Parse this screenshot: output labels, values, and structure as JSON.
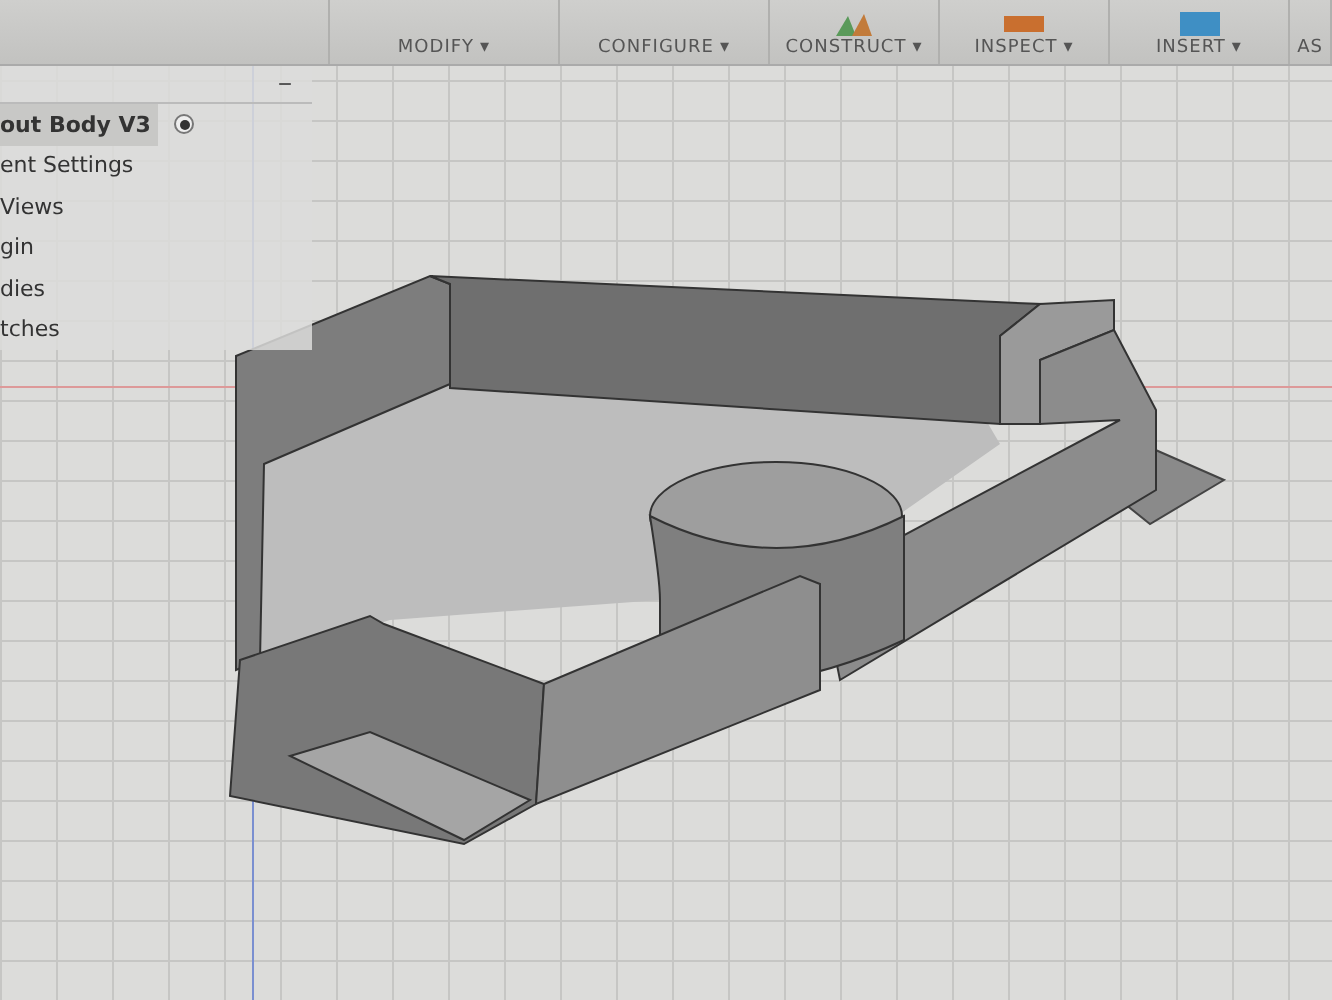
{
  "toolbar": {
    "menus": [
      {
        "label": "MODIFY",
        "caret": "▾"
      },
      {
        "label": "CONFIGURE",
        "caret": "▾"
      },
      {
        "label": "CONSTRUCT",
        "caret": "▾"
      },
      {
        "label": "INSPECT",
        "caret": "▾"
      },
      {
        "label": "INSERT",
        "caret": "▾"
      },
      {
        "label": "AS"
      }
    ]
  },
  "browser": {
    "collapse": "−",
    "items": [
      {
        "label": "out Body V3",
        "kind": "root",
        "active": true
      },
      {
        "label": "ent Settings",
        "kind": "folder"
      },
      {
        "label": "Views",
        "kind": "folder"
      },
      {
        "label": "gin",
        "kind": "folder"
      },
      {
        "label": "dies",
        "kind": "folder"
      },
      {
        "label": "tches",
        "kind": "folder"
      }
    ]
  }
}
